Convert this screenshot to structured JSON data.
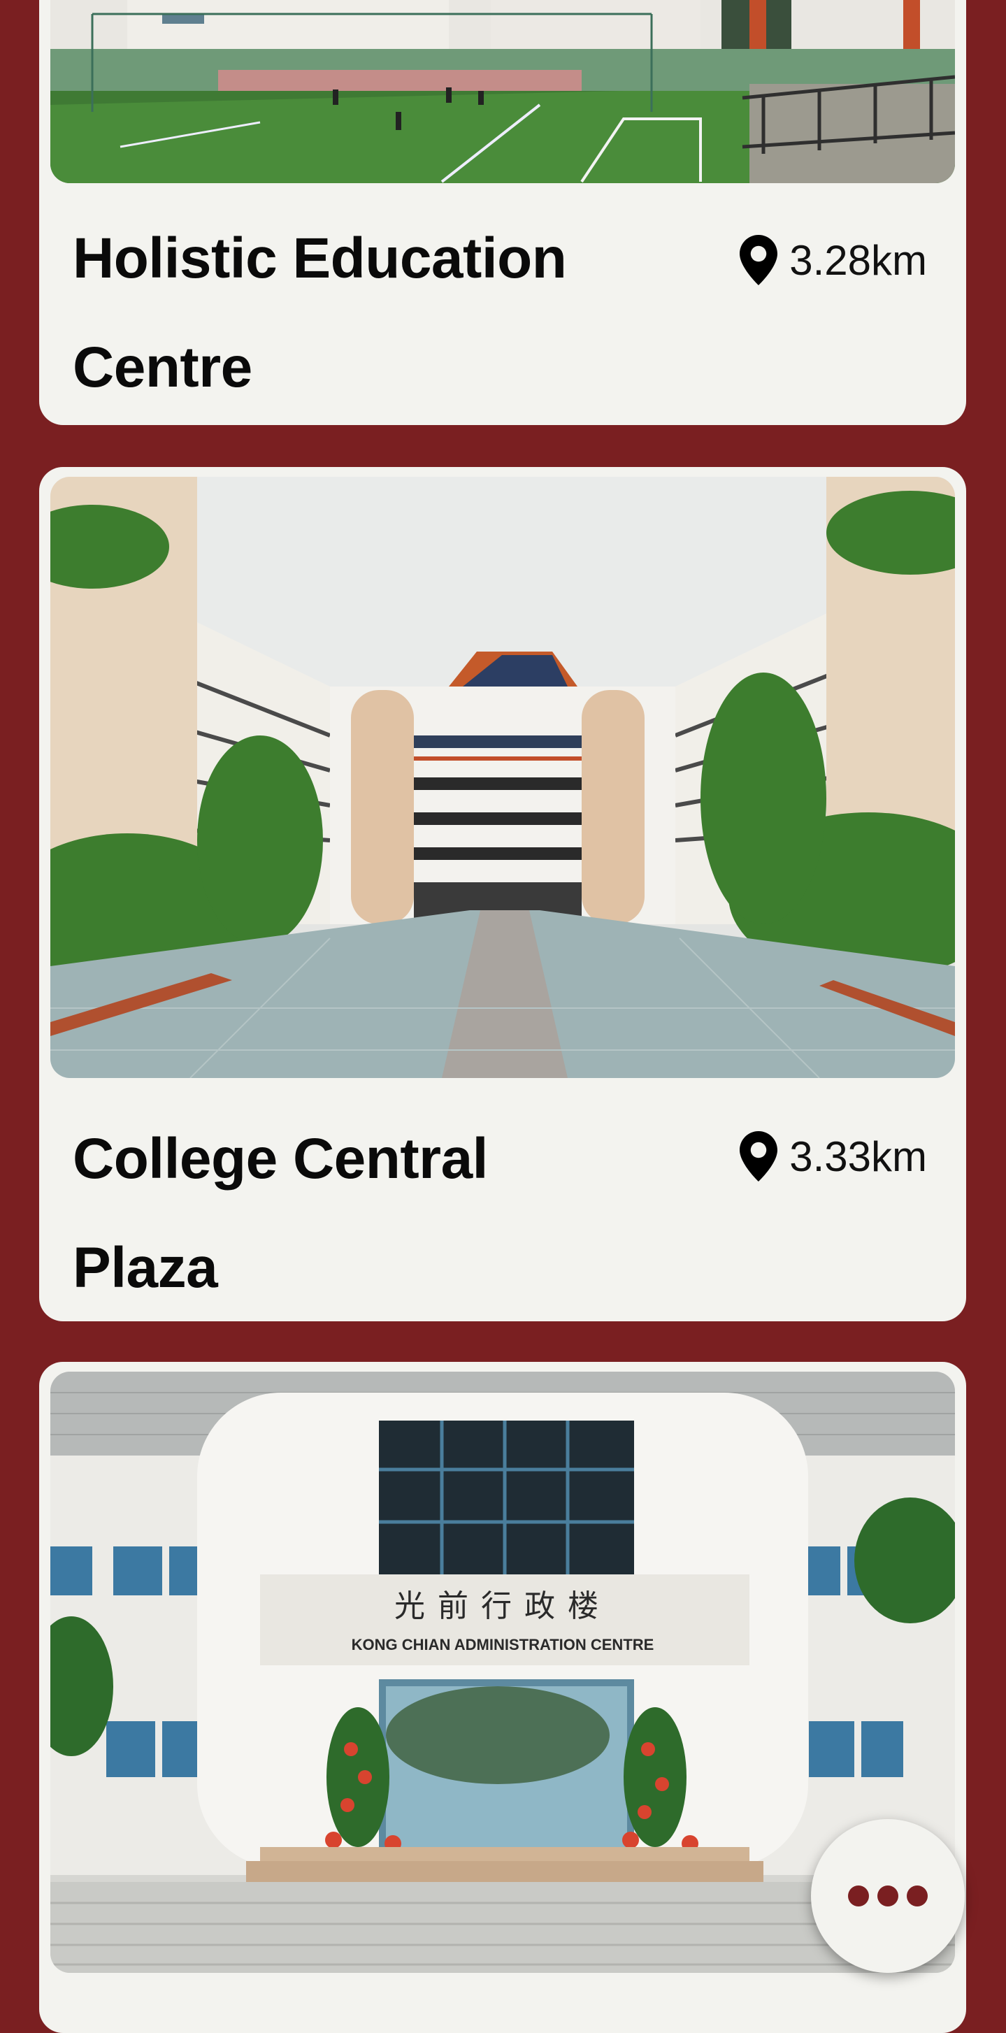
{
  "cards": [
    {
      "title_line1": "Holistic Education",
      "title_line2": "Centre",
      "distance": "3.28km"
    },
    {
      "title_line1": "College Central",
      "title_line2": "Plaza",
      "distance": "3.33km"
    },
    {
      "sign_chinese": "光前行政楼",
      "sign_english": "KONG CHIAN ADMINISTRATION CENTRE"
    }
  ],
  "icons": {
    "distance": "map-pin-icon",
    "more": "more-horizontal-icon"
  },
  "colors": {
    "background": "#7a1f21",
    "card": "#f3f3ef",
    "text": "#0a0a0a",
    "fab_dots": "#7a1f21"
  }
}
